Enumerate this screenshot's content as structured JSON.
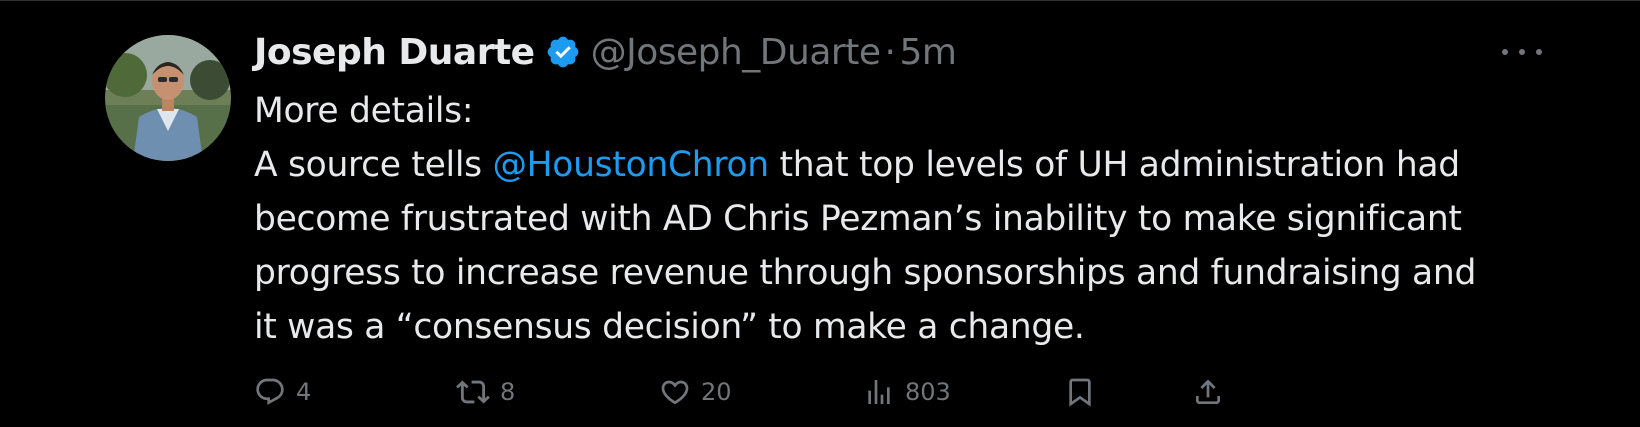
{
  "tweet": {
    "author_name": "Joseph Duarte",
    "author_handle": "@Joseph_Duarte",
    "separator": "·",
    "time_ago": "5m",
    "verified": true,
    "text_lines": [
      "More details:",
      "A source tells ",
      "@HoustonChron",
      " that top levels of UH administration had",
      "become frustrated with AD Chris Pezman’s inability to make significant",
      "progress to increase revenue through sponsorships and fundraising and",
      "it was a “consensus decision” to make a change."
    ],
    "mention": "@HoustonChron"
  },
  "actions": {
    "replies": "4",
    "retweets": "8",
    "likes": "20",
    "views": "803"
  },
  "colors": {
    "background": "#000000",
    "text": "#e7e9ea",
    "secondary": "#71767b",
    "accent": "#1d9bf0"
  },
  "icons": {
    "verified": "verified-badge-icon",
    "more": "more-options-icon",
    "reply": "reply-icon",
    "retweet": "retweet-icon",
    "like": "heart-icon",
    "views": "views-icon",
    "bookmark": "bookmark-icon",
    "share": "share-icon"
  }
}
